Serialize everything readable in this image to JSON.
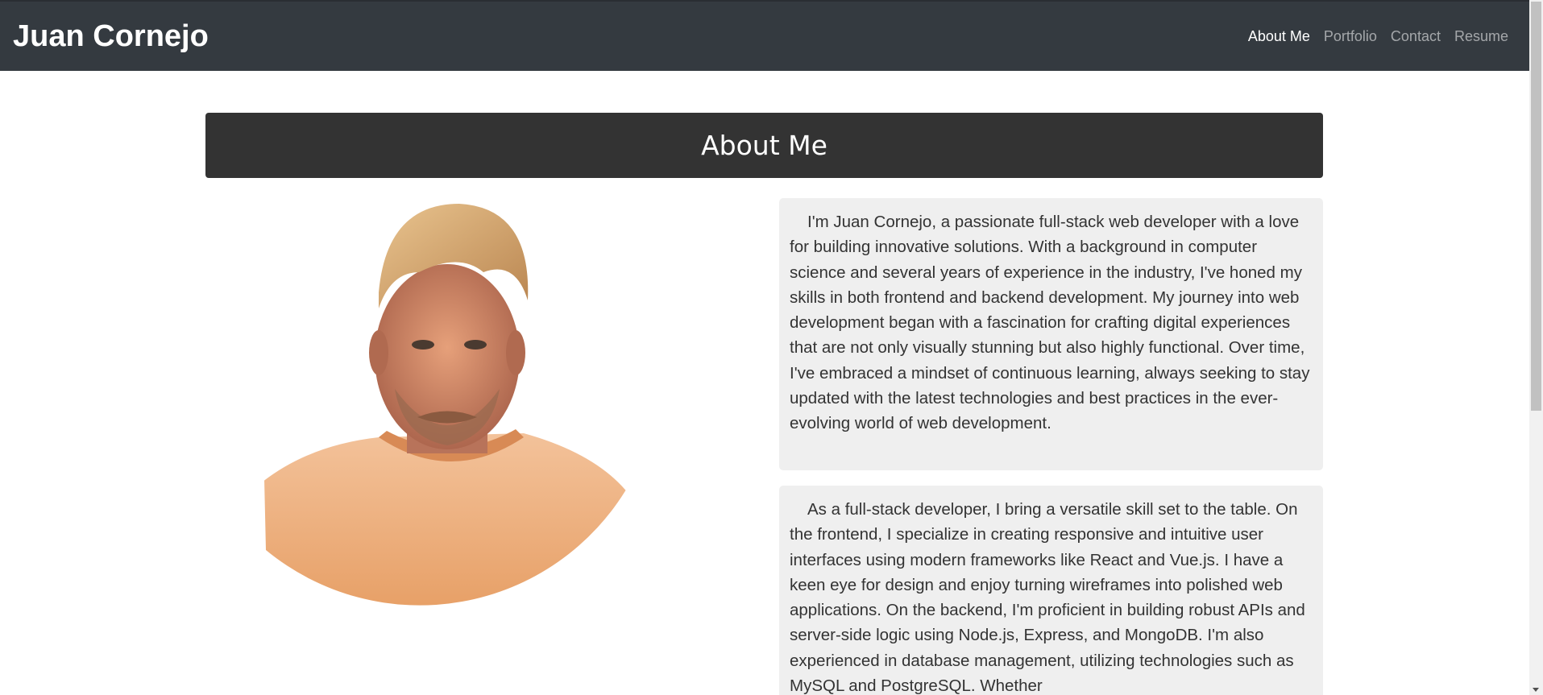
{
  "brand": "Juan Cornejo",
  "nav": {
    "items": [
      "About Me",
      "Portfolio",
      "Contact",
      "Resume"
    ],
    "active": "About Me"
  },
  "section_title": "About Me",
  "about": {
    "paragraphs": [
      "I'm Juan Cornejo, a passionate full-stack web developer with a love for building innovative solutions. With a background in computer science and several years of experience in the industry, I've honed my skills in both frontend and backend development. My journey into web development began with a fascination for crafting digital experiences that are not only visually stunning but also highly functional. Over time, I've embraced a mindset of continuous learning, always seeking to stay updated with the latest technologies and best practices in the ever-evolving world of web development.",
      "As a full-stack developer, I bring a versatile skill set to the table. On the frontend, I specialize in creating responsive and intuitive user interfaces using modern frameworks like React and Vue.js. I have a keen eye for design and enjoy turning wireframes into polished web applications. On the backend, I'm proficient in building robust APIs and server-side logic using Node.js, Express, and MongoDB. I'm also experienced in database management, utilizing technologies such as MySQL and PostgreSQL. Whether"
    ]
  },
  "colors": {
    "navbar_bg": "#343a40",
    "title_bg": "#333333",
    "paragraph_bg": "#efefef",
    "text": "#333333"
  }
}
